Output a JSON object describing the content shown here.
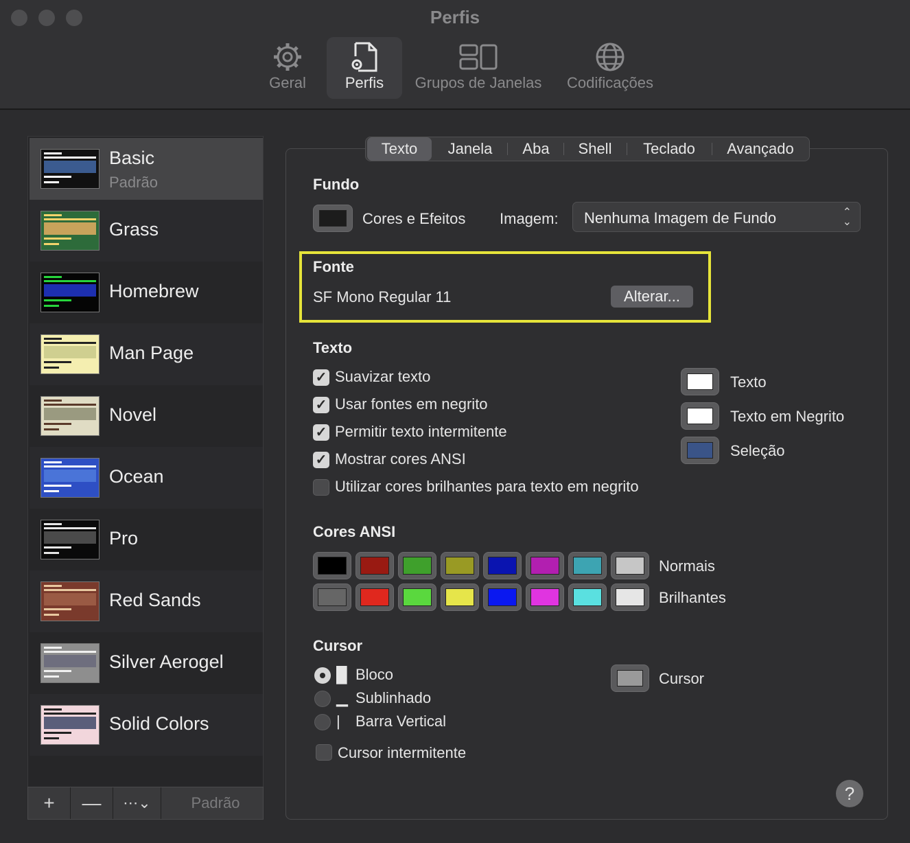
{
  "window": {
    "title": "Perfis"
  },
  "toolbar": [
    {
      "label": "Geral",
      "icon": "gear-icon"
    },
    {
      "label": "Perfis",
      "icon": "document-gear-icon",
      "active": true
    },
    {
      "label": "Grupos de Janelas",
      "icon": "windows-group-icon"
    },
    {
      "label": "Codificações",
      "icon": "globe-icon"
    }
  ],
  "profiles": [
    {
      "name": "Basic",
      "subtitle": "Padrão",
      "bg": "#111111",
      "accent": "#3b5b8f",
      "text": "#ffffff"
    },
    {
      "name": "Grass",
      "bg": "#2d6b3a",
      "accent": "#c8a35b",
      "text": "#f2d36b"
    },
    {
      "name": "Homebrew",
      "bg": "#050505",
      "accent": "#1d2fb0",
      "text": "#27d53c"
    },
    {
      "name": "Man Page",
      "bg": "#f4eeb0",
      "accent": "#cfcf90",
      "text": "#222222"
    },
    {
      "name": "Novel",
      "bg": "#e0dcc4",
      "accent": "#9a9a80",
      "text": "#5a3a2a"
    },
    {
      "name": "Ocean",
      "bg": "#2e4fc4",
      "accent": "#4a74d8",
      "text": "#ffffff"
    },
    {
      "name": "Pro",
      "bg": "#0a0a0a",
      "accent": "#4a4a4a",
      "text": "#e6e6e6"
    },
    {
      "name": "Red Sands",
      "bg": "#7a3a2c",
      "accent": "#9a5a44",
      "text": "#e8c8a0"
    },
    {
      "name": "Silver Aerogel",
      "bg": "#8e8e8e",
      "accent": "#6e6e7e",
      "text": "#f0f0f0"
    },
    {
      "name": "Solid Colors",
      "bg": "#f2d6dc",
      "accent": "#5a5e7a",
      "text": "#222222"
    }
  ],
  "sidebar_footer": {
    "add": "+",
    "remove": "—",
    "more": "⋯⌄",
    "default_label": "Padrão"
  },
  "tabs": [
    "Texto",
    "Janela",
    "Aba",
    "Shell",
    "Teclado",
    "Avançado"
  ],
  "active_tab": "Texto",
  "background": {
    "heading": "Fundo",
    "effects_label": "Cores e Efeitos",
    "image_label": "Imagem:",
    "image_value": "Nenhuma Imagem de Fundo",
    "swatch_color": "#1c1c1c"
  },
  "font": {
    "heading": "Fonte",
    "value": "SF Mono Regular 11",
    "change_button": "Alterar..."
  },
  "text": {
    "heading": "Texto",
    "options": [
      {
        "label": "Suavizar texto",
        "checked": true
      },
      {
        "label": "Usar fontes em negrito",
        "checked": true
      },
      {
        "label": "Permitir texto intermitente",
        "checked": true
      },
      {
        "label": "Mostrar cores ANSI",
        "checked": true
      },
      {
        "label": "Utilizar cores brilhantes para texto em negrito",
        "checked": false
      }
    ],
    "colors": [
      {
        "label": "Texto",
        "color": "#ffffff"
      },
      {
        "label": "Texto em Negrito",
        "color": "#ffffff"
      },
      {
        "label": "Seleção",
        "color": "#3a5488"
      }
    ]
  },
  "ansi": {
    "heading": "Cores ANSI",
    "normal_label": "Normais",
    "bright_label": "Brilhantes",
    "normal": [
      "#000000",
      "#991a12",
      "#3fa02c",
      "#999a24",
      "#0a14b0",
      "#b21fb0",
      "#3da4b2",
      "#c6c6c6"
    ],
    "bright": [
      "#666666",
      "#e0281e",
      "#5ad83e",
      "#e6e54a",
      "#0a18f0",
      "#e034e0",
      "#5ae0e0",
      "#e6e6e6"
    ]
  },
  "cursor": {
    "heading": "Cursor",
    "options": [
      {
        "glyph": "█",
        "label": "Bloco",
        "selected": true
      },
      {
        "glyph": "▁",
        "label": "Sublinhado",
        "selected": false
      },
      {
        "glyph": "|",
        "label": "Barra Vertical",
        "selected": false
      }
    ],
    "blink_label": "Cursor intermitente",
    "blink_checked": false,
    "color_label": "Cursor",
    "color": "#9a9a9a"
  },
  "help_label": "?"
}
